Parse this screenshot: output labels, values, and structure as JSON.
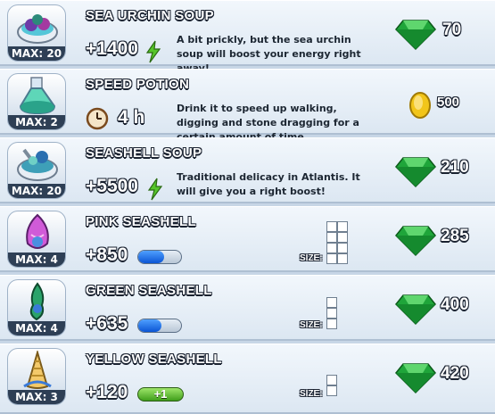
{
  "items": [
    {
      "name": "SEA URCHIN SOUP",
      "max": "MAX: 20",
      "value": "+1400",
      "description": "A bit prickly, but the sea urchin soup will boost your energy right away!",
      "price": "70",
      "currency": "gem",
      "value_icon": "energy-bolt",
      "thumb_icon": "sea-urchin-soup-icon"
    },
    {
      "name": "SPEED POTION",
      "max": "MAX: 2",
      "value": "4 h",
      "description": "Drink it to speed up walking, digging and stone dragging for a certain amount of time.",
      "price": "500",
      "currency": "coin",
      "value_icon": "clock",
      "thumb_icon": "speed-potion-icon"
    },
    {
      "name": "SEASHELL SOUP",
      "max": "MAX: 20",
      "value": "+5500",
      "description": "Traditional delicacy in Atlantis. It will give you a right boost!",
      "price": "210",
      "currency": "gem",
      "value_icon": "energy-bolt",
      "thumb_icon": "seashell-soup-icon"
    },
    {
      "name": "PINK SEASHELL",
      "max": "MAX: 4",
      "value": "+850",
      "price": "285",
      "currency": "gem",
      "size_label": "SIZE:",
      "size_cols": 2,
      "size_rows": 4,
      "energy_bar": 0.6,
      "thumb_icon": "pink-seashell-icon"
    },
    {
      "name": "GREEN SEASHELL",
      "max": "MAX: 4",
      "value": "+635",
      "price": "400",
      "currency": "gem",
      "size_label": "SIZE:",
      "size_cols": 1,
      "size_rows": 3,
      "energy_bar": 0.55,
      "thumb_icon": "green-seashell-icon"
    },
    {
      "name": "YELLOW SEASHELL",
      "max": "MAX: 3",
      "value": "+120",
      "price": "420",
      "currency": "gem",
      "size_label": "SIZE:",
      "size_cols": 1,
      "size_rows": 2,
      "green_badge": "+1",
      "thumb_icon": "yellow-seashell-icon"
    }
  ],
  "colors": {
    "gem": "#1fa53a",
    "coin": "#f2c51a",
    "bolt": "#56c52a",
    "row_bg": "#e8f0f8",
    "max_bg": "#2e3f55"
  }
}
